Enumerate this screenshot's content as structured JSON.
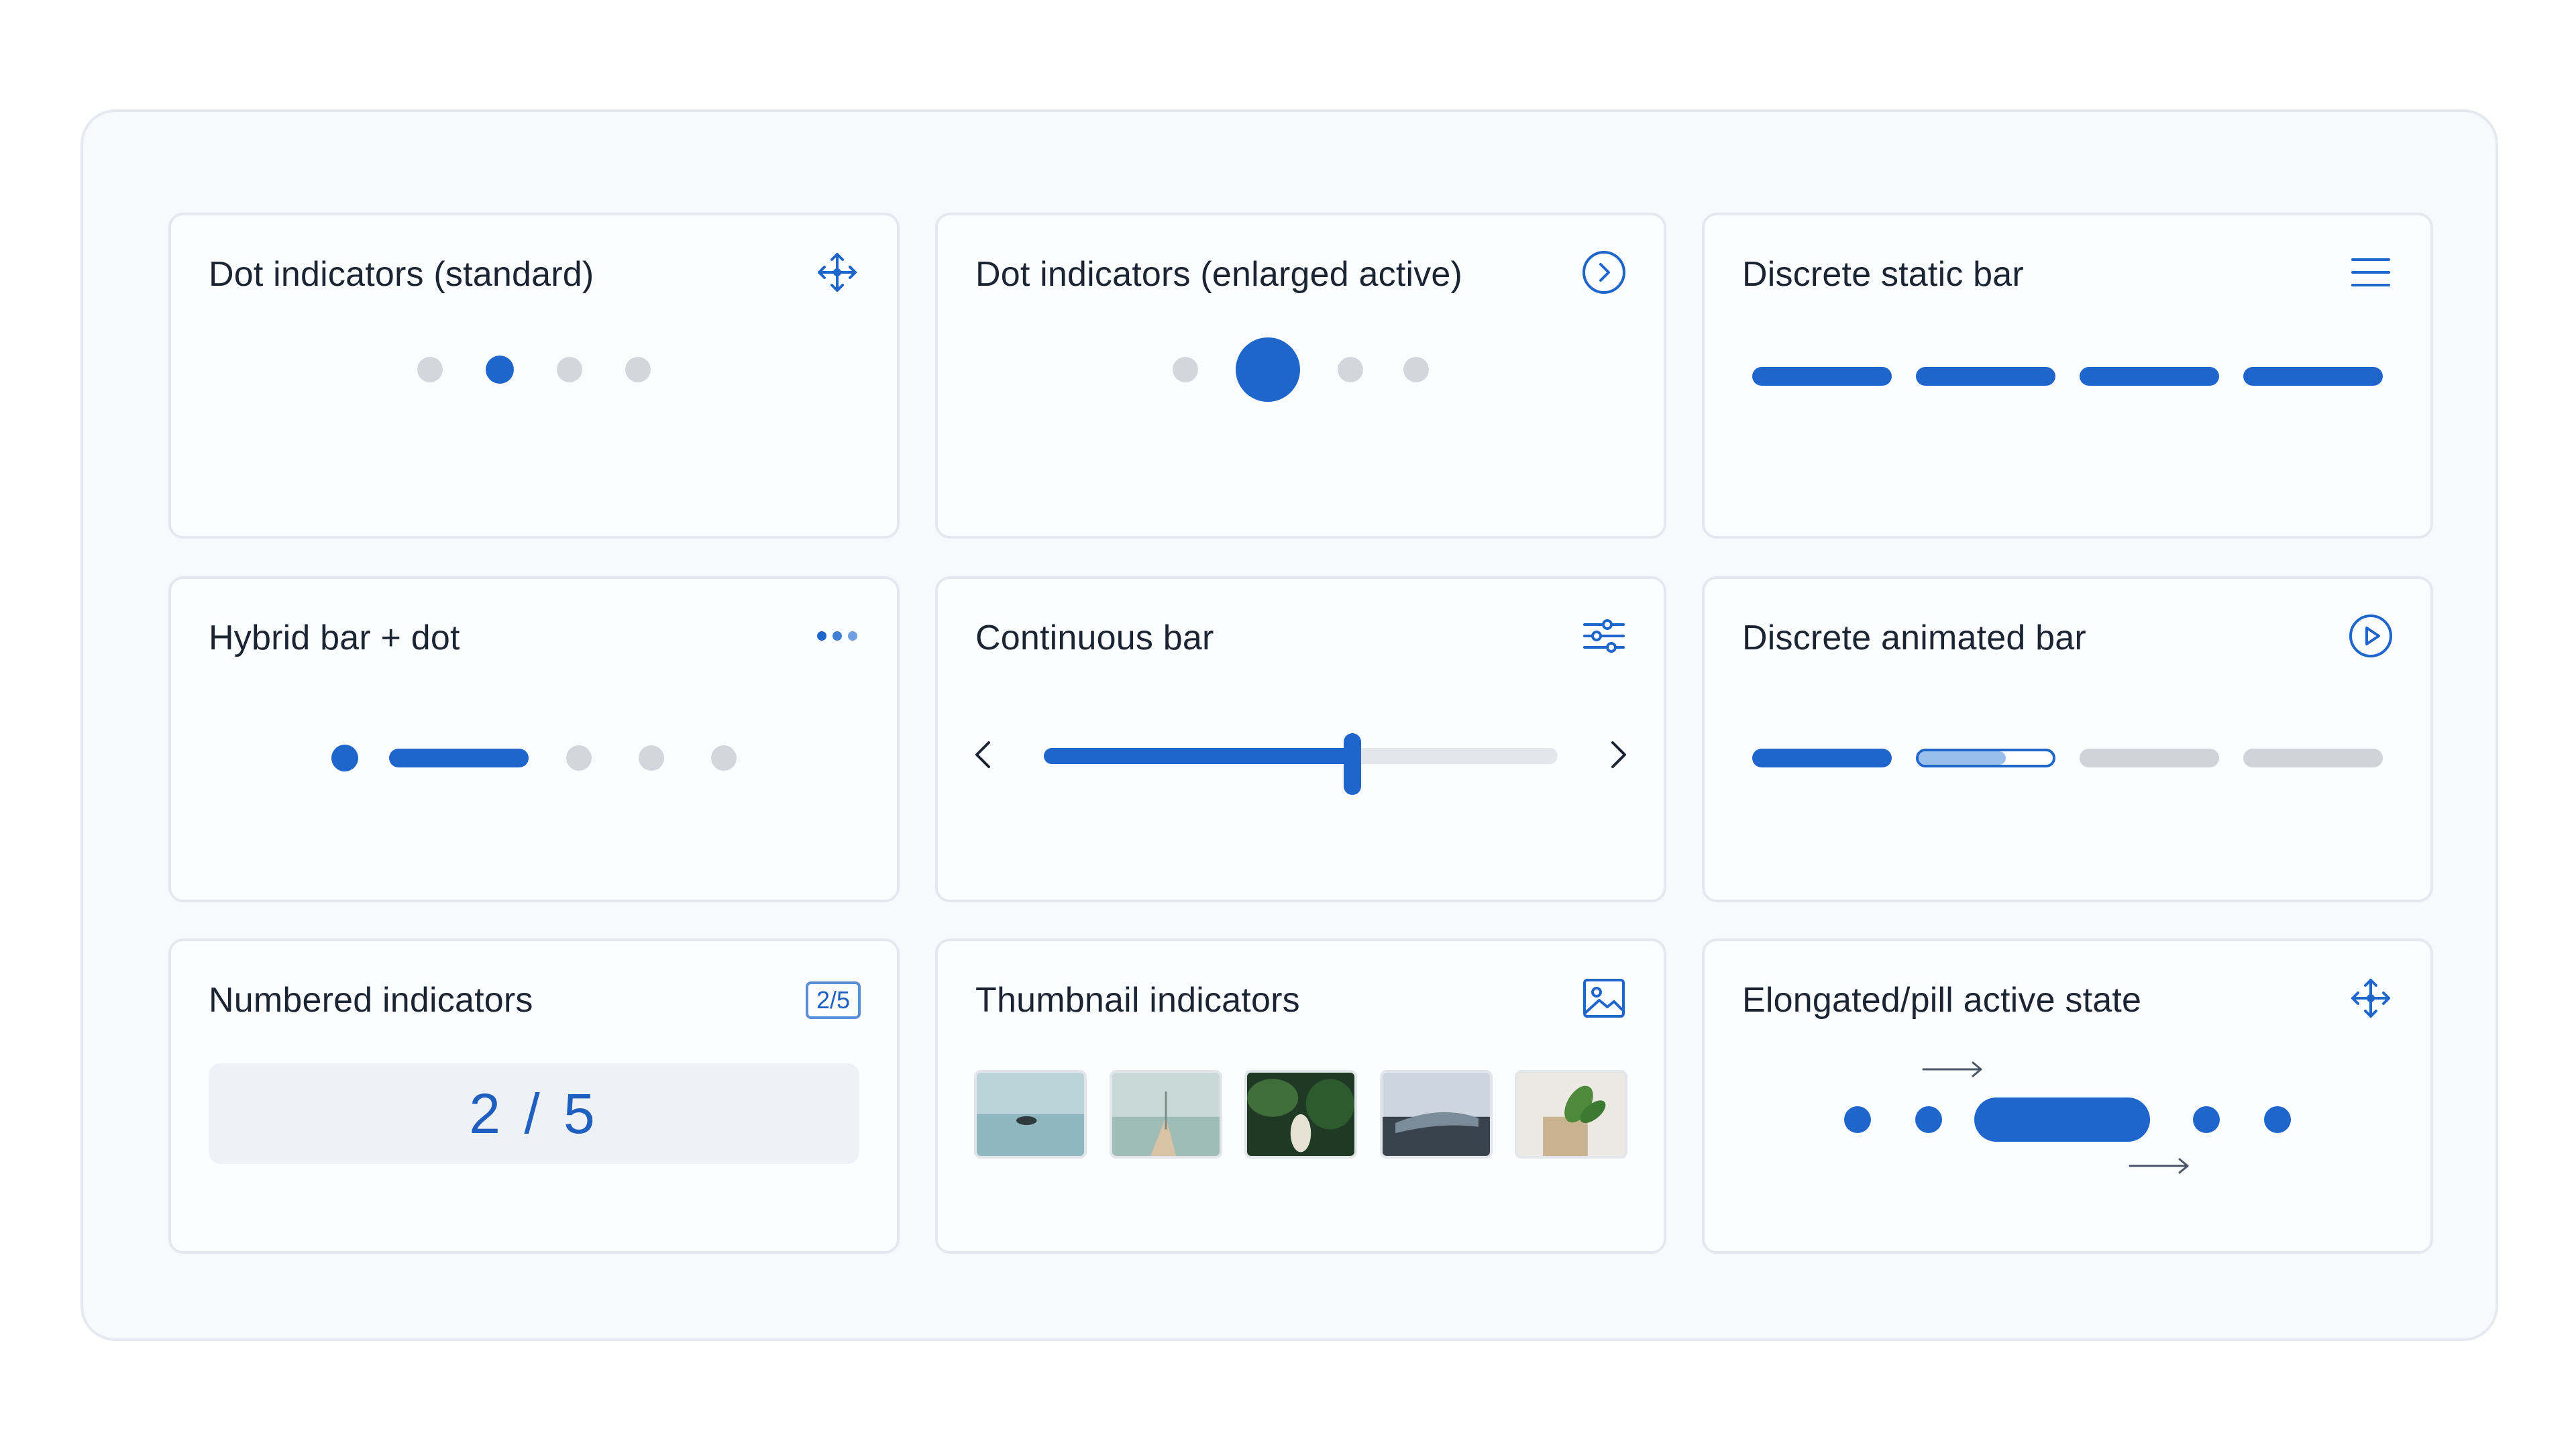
{
  "colors": {
    "accent": "#1f66cc",
    "inactive": "#d3d6dc",
    "text": "#1b2433"
  },
  "cards": {
    "dot_standard": {
      "title": "Dot indicators (standard)",
      "icon": "move-arrows-icon",
      "count": 4,
      "active_index": 1
    },
    "dot_enlarged": {
      "title": "Dot indicators (enlarged active)",
      "icon": "chevron-right-circle-icon",
      "count": 4,
      "active_index": 1
    },
    "discrete_static": {
      "title": "Discrete static bar",
      "icon": "menu-lines-icon",
      "count": 4
    },
    "hybrid": {
      "title": "Hybrid bar + dot",
      "icon": "more-dots-icon",
      "active_index": 1,
      "count": 5
    },
    "continuous": {
      "title": "Continuous bar",
      "icon": "sliders-icon",
      "progress": 0.6
    },
    "discrete_animated": {
      "title": "Discrete animated bar",
      "icon": "play-circle-icon",
      "count": 4,
      "active_index": 1,
      "active_progress": 0.65
    },
    "numbered": {
      "title": "Numbered indicators",
      "badge": "2/5",
      "value": "2 / 5"
    },
    "thumbnail": {
      "title": "Thumbnail indicators",
      "icon": "image-icon",
      "count": 5
    },
    "pill": {
      "title": "Elongated/pill active state",
      "icon": "move-arrows-icon",
      "count": 5,
      "active_index": 2
    }
  }
}
